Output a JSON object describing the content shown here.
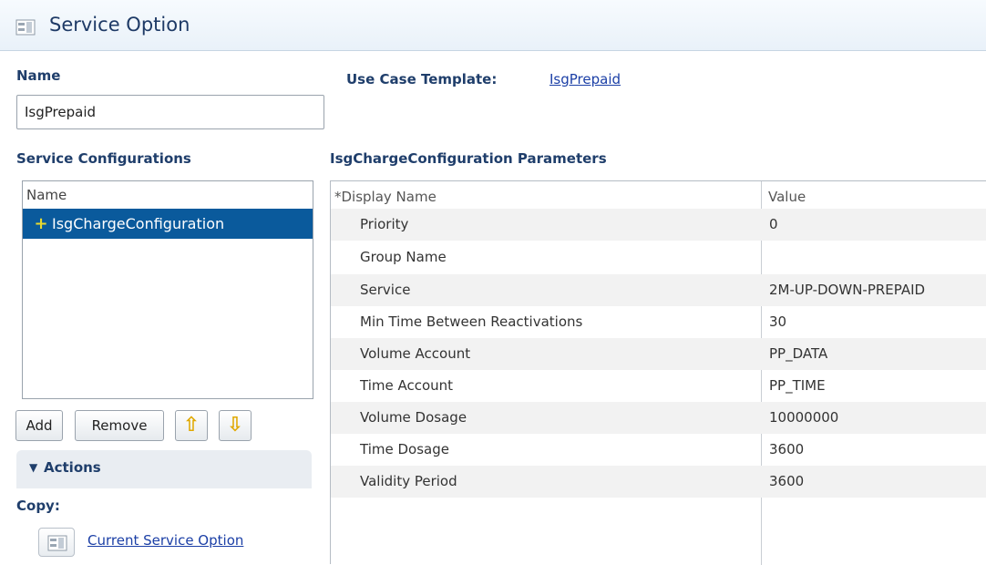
{
  "header": {
    "title": "Service Option",
    "icon": "service-option-icon"
  },
  "name_section": {
    "label": "Name",
    "value": "IsgPrepaid"
  },
  "use_case": {
    "label": "Use Case Template:",
    "link": "IsgPrepaid"
  },
  "service_configurations": {
    "label": "Service Configurations",
    "column_header": "Name",
    "items": [
      {
        "label": "IsgChargeConfiguration",
        "icon": "plus-icon"
      }
    ]
  },
  "buttons": {
    "add": "Add",
    "remove": "Remove",
    "move_up": "⇧",
    "move_down": "⇩"
  },
  "actions": {
    "label": "Actions",
    "copy_label": "Copy:",
    "current_service_option": "Current Service Option"
  },
  "parameters": {
    "title": "IsgChargeConfiguration Parameters",
    "columns": [
      "*Display Name",
      "Value"
    ],
    "rows": [
      {
        "name": "Priority",
        "value": "0"
      },
      {
        "name": "Group Name",
        "value": ""
      },
      {
        "name": "Service",
        "value": "2M-UP-DOWN-PREPAID"
      },
      {
        "name": "Min Time Between Reactivations",
        "value": "30"
      },
      {
        "name": "Volume Account",
        "value": "PP_DATA"
      },
      {
        "name": "Time Account",
        "value": "PP_TIME"
      },
      {
        "name": "Volume Dosage",
        "value": "10000000"
      },
      {
        "name": "Time Dosage",
        "value": "3600"
      },
      {
        "name": "Validity Period",
        "value": "3600"
      }
    ]
  },
  "colors": {
    "selection": "#0a5a9c",
    "heading": "#1f3e6b",
    "link": "#1b3fa6",
    "arrow": "#e0a800"
  }
}
